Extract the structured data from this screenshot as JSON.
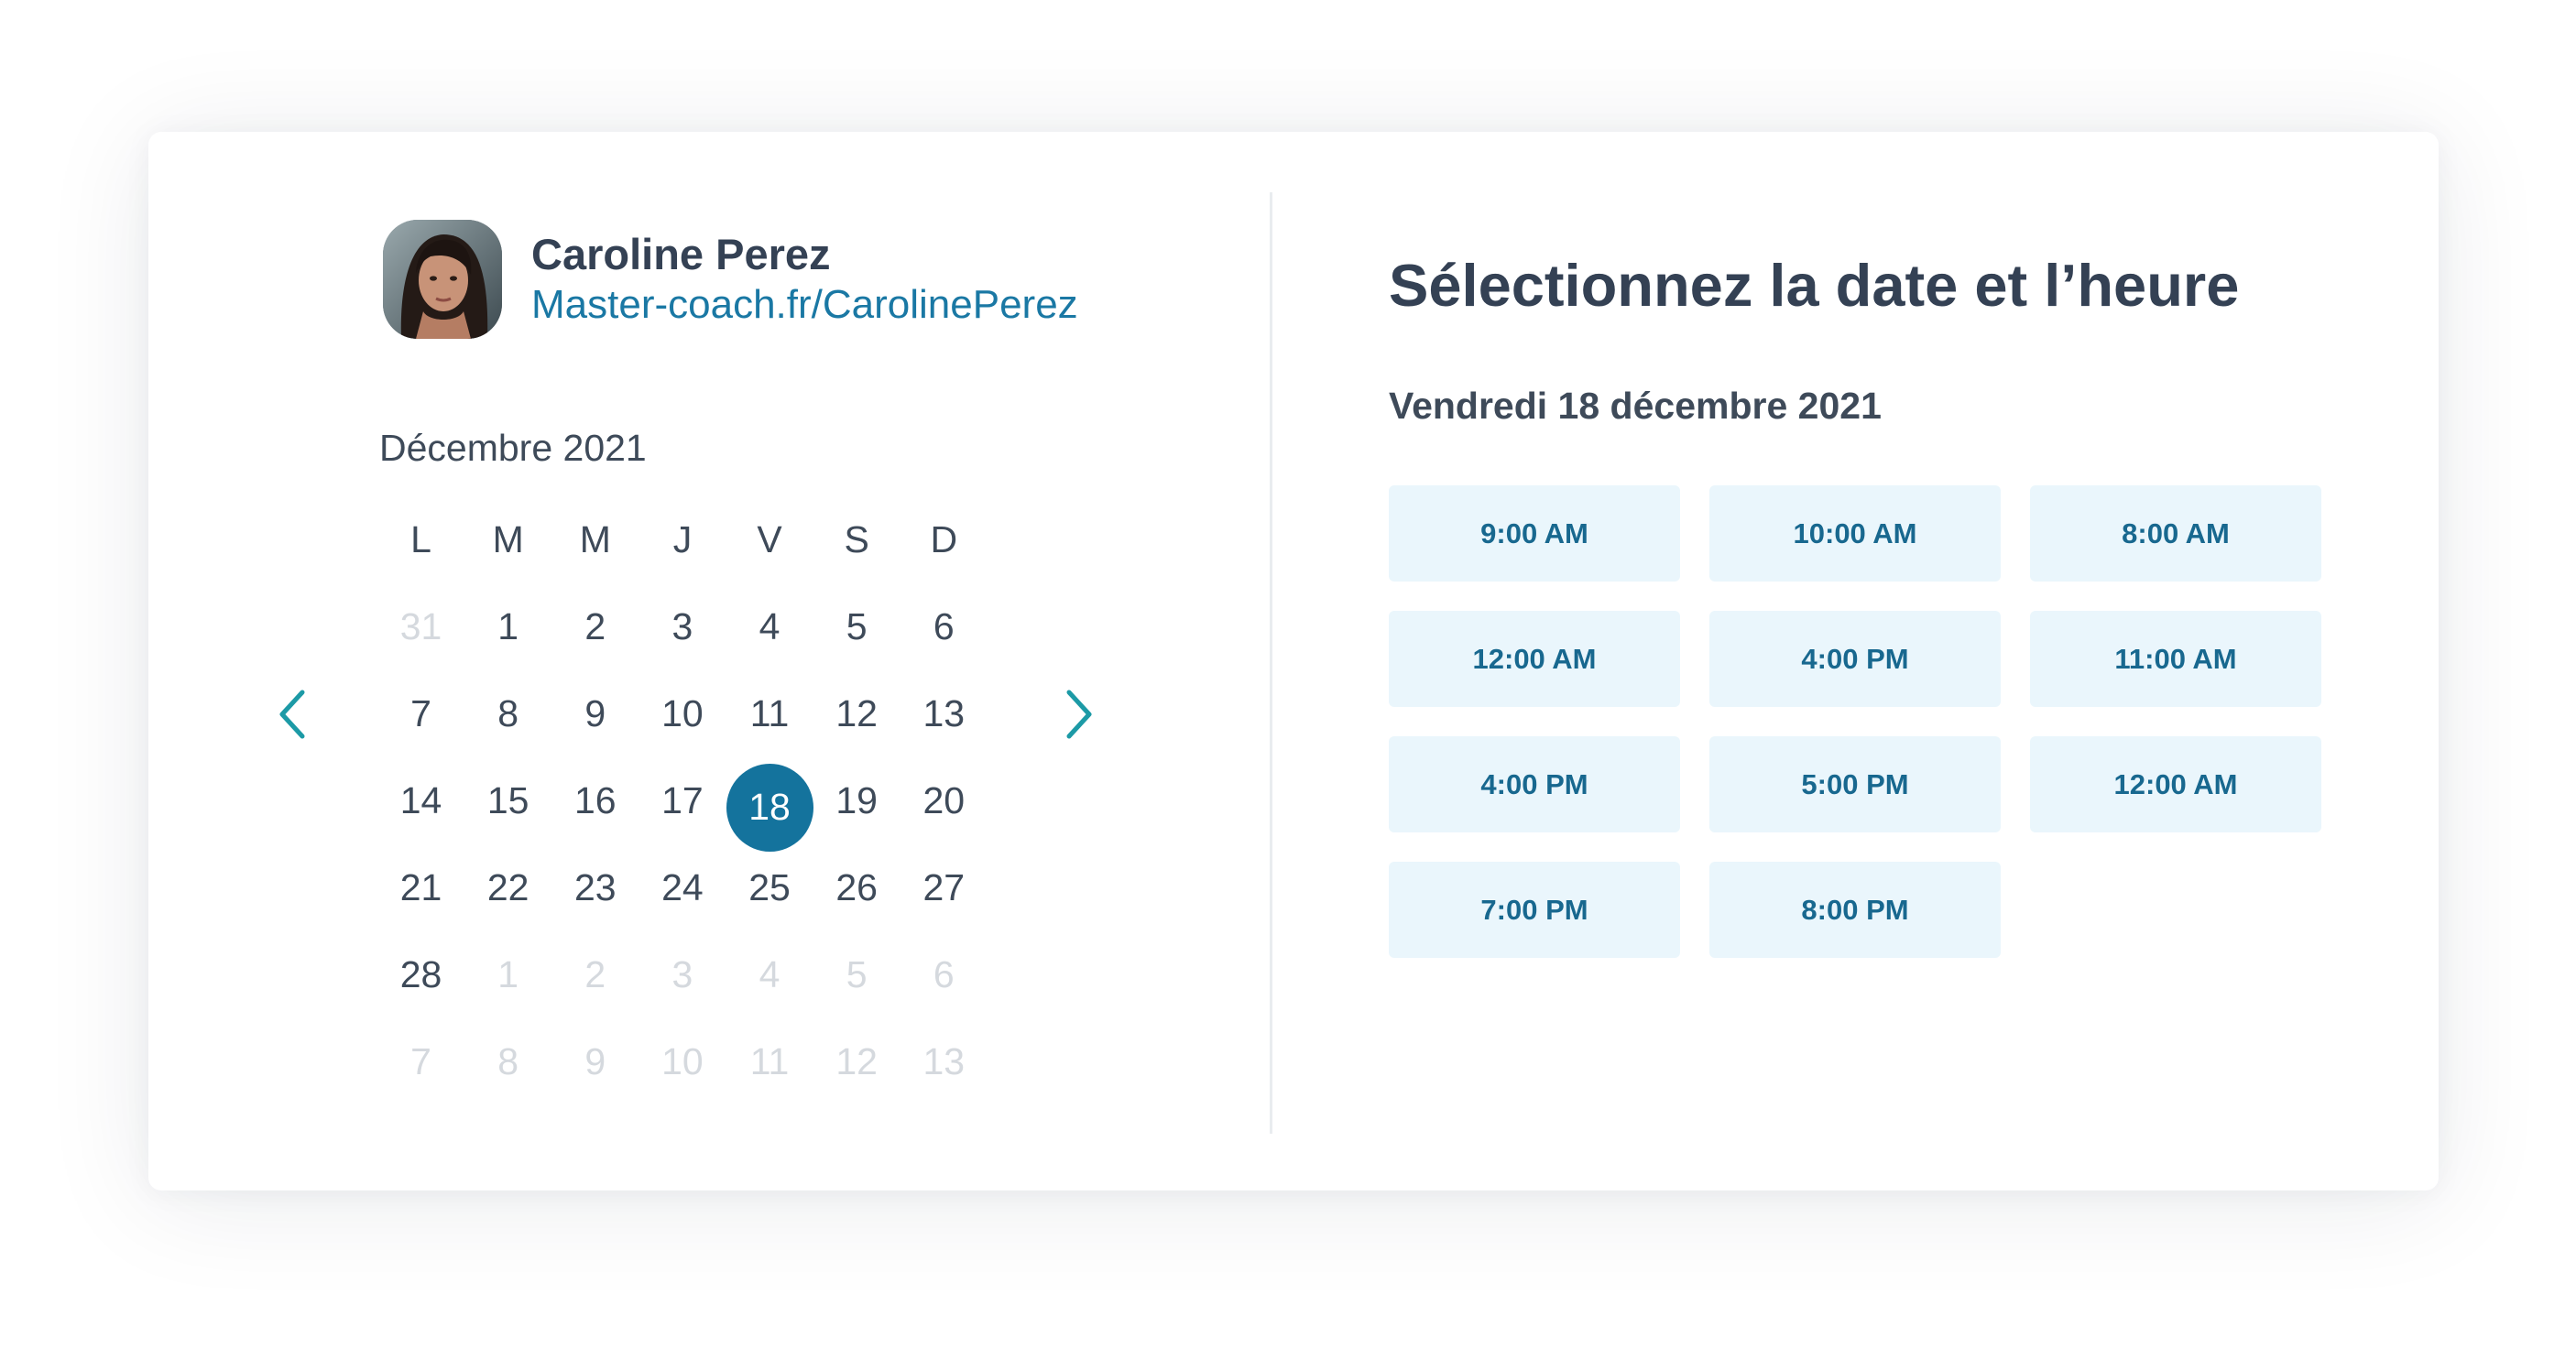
{
  "host": {
    "name": "Caroline Perez",
    "link": "Master-coach.fr/CarolinePerez"
  },
  "calendar": {
    "month_label": "Décembre 2021",
    "weekdays": [
      "L",
      "M",
      "M",
      "J",
      "V",
      "S",
      "D"
    ],
    "days": [
      {
        "label": "31",
        "muted": true
      },
      {
        "label": "1",
        "muted": false
      },
      {
        "label": "2",
        "muted": false
      },
      {
        "label": "3",
        "muted": false
      },
      {
        "label": "4",
        "muted": false
      },
      {
        "label": "5",
        "muted": false
      },
      {
        "label": "6",
        "muted": false
      },
      {
        "label": "7",
        "muted": false
      },
      {
        "label": "8",
        "muted": false
      },
      {
        "label": "9",
        "muted": false
      },
      {
        "label": "10",
        "muted": false
      },
      {
        "label": "11",
        "muted": false
      },
      {
        "label": "12",
        "muted": false
      },
      {
        "label": "13",
        "muted": false
      },
      {
        "label": "14",
        "muted": false
      },
      {
        "label": "15",
        "muted": false
      },
      {
        "label": "16",
        "muted": false
      },
      {
        "label": "17",
        "muted": false
      },
      {
        "label": "18",
        "muted": false,
        "selected": true
      },
      {
        "label": "19",
        "muted": false
      },
      {
        "label": "20",
        "muted": false
      },
      {
        "label": "21",
        "muted": false
      },
      {
        "label": "22",
        "muted": false
      },
      {
        "label": "23",
        "muted": false
      },
      {
        "label": "24",
        "muted": false
      },
      {
        "label": "25",
        "muted": false
      },
      {
        "label": "26",
        "muted": false
      },
      {
        "label": "27",
        "muted": false
      },
      {
        "label": "28",
        "muted": false
      },
      {
        "label": "1",
        "muted": true
      },
      {
        "label": "2",
        "muted": true
      },
      {
        "label": "3",
        "muted": true
      },
      {
        "label": "4",
        "muted": true
      },
      {
        "label": "5",
        "muted": true
      },
      {
        "label": "6",
        "muted": true
      },
      {
        "label": "7",
        "muted": true
      },
      {
        "label": "8",
        "muted": true
      },
      {
        "label": "9",
        "muted": true
      },
      {
        "label": "10",
        "muted": true
      },
      {
        "label": "11",
        "muted": true
      },
      {
        "label": "12",
        "muted": true
      },
      {
        "label": "13",
        "muted": true
      }
    ],
    "prev_icon": "chevron-left-icon",
    "next_icon": "chevron-right-icon"
  },
  "booking": {
    "title": "Sélectionnez la date et l’heure",
    "selected_date": "Vendredi 18 décembre 2021",
    "slots": [
      "9:00 AM",
      "10:00 AM",
      "8:00 AM",
      "12:00 AM",
      "4:00 PM",
      "11:00 AM",
      "4:00 PM",
      "5:00 PM",
      "12:00 AM",
      "7:00 PM",
      "8:00 PM"
    ]
  },
  "colors": {
    "accent": "#14739d",
    "link": "#1a78a4",
    "chevron": "#1c9aa6",
    "slot_bg": "#eaf6fc",
    "slot_text": "#18688f",
    "text": "#344154",
    "muted": "#d5d9de"
  }
}
